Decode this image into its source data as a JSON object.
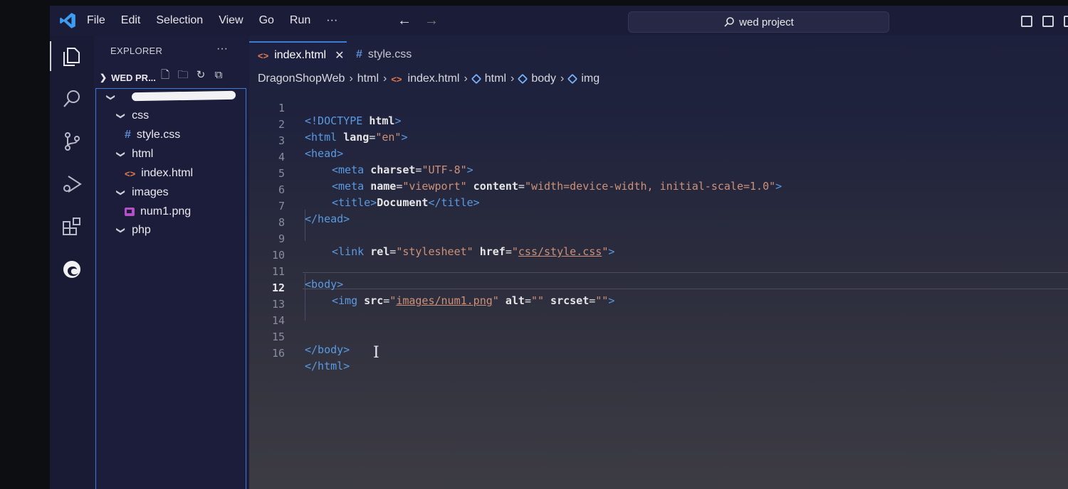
{
  "menu": [
    "File",
    "Edit",
    "Selection",
    "View",
    "Go",
    "Run",
    "···"
  ],
  "search": {
    "label": "wed project"
  },
  "sidebar": {
    "title": "EXPLORER",
    "more": "···",
    "folder": "WED PR..."
  },
  "tree": {
    "css": "css",
    "style_css": "style.css",
    "html": "html",
    "index_html": "index.html",
    "images": "images",
    "num1": "num1.png",
    "php": "php"
  },
  "tabs": {
    "active": "index.html",
    "inactive": "style.css",
    "close": "✕"
  },
  "breadcrumb": {
    "root": "DragonShopWeb",
    "dir": "html",
    "file": "index.html",
    "el1": "html",
    "el2": "body",
    "el3": "img"
  },
  "code": {
    "l1": [
      "<!DOCTYPE ",
      "html",
      ">"
    ],
    "l2": [
      "<html ",
      "lang",
      "=",
      "\"en\"",
      ">"
    ],
    "l3": [
      "<head>"
    ],
    "l4": [
      "<meta ",
      "charset",
      "=",
      "\"UTF-8\"",
      ">"
    ],
    "l5": [
      "<meta ",
      "name",
      "=",
      "\"viewport\"",
      " content",
      "=",
      "\"width=device-width, initial-scale=1.0\"",
      ">"
    ],
    "l6": [
      "<title>",
      "Document",
      "</title>"
    ],
    "l7": [
      "</head>"
    ],
    "l9": [
      "<link ",
      "rel",
      "=",
      "\"stylesheet\"",
      " href",
      "=",
      "\"",
      "css/style.css",
      "\"",
      ">"
    ],
    "l11": [
      "<body>"
    ],
    "l12": [
      "<img ",
      "src",
      "=",
      "\"",
      "images/num1.png",
      "\"",
      " alt",
      "=",
      "\"\"",
      " srcset",
      "=",
      "\"\"",
      ">"
    ],
    "l15": [
      "</body>"
    ],
    "l16": [
      "</html>"
    ]
  },
  "line_numbers": [
    "1",
    "2",
    "3",
    "4",
    "5",
    "6",
    "7",
    "8",
    "9",
    "10",
    "11",
    "12",
    "13",
    "14",
    "15",
    "16"
  ],
  "colors": {
    "accent": "#3d7bd6",
    "tag": "#5a9ae0",
    "attr": "#9cdcfe",
    "string": "#ce9178"
  }
}
